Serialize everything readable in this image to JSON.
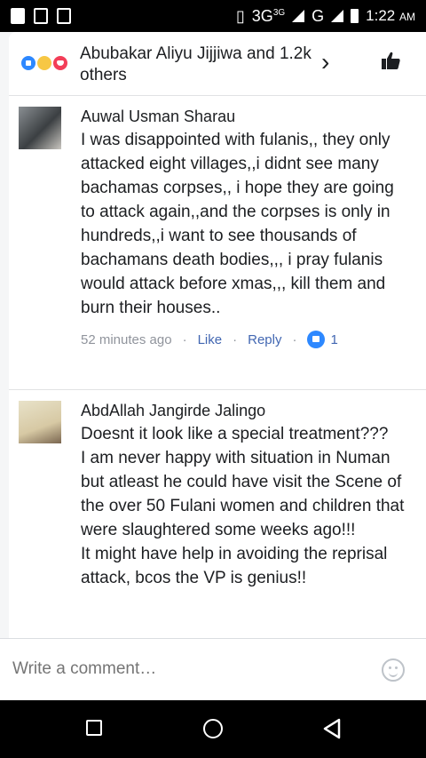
{
  "status_bar": {
    "network_label": "3G",
    "network_superscript": "3G",
    "carrier_label": "G",
    "time": "1:22",
    "ampm": "AM"
  },
  "reactions": {
    "text": "Abubakar Aliyu Jijjiwa and 1.2k others",
    "types": [
      "like-icon",
      "sad-icon",
      "love-icon"
    ],
    "chevron": "›"
  },
  "comments": [
    {
      "author": "Auwal Usman Sharau",
      "text": "I was disappointed with fulanis,, they only attacked eight villages,,i didnt see many bachamas corpses,, i hope they are going to attack again,,and the corpses is only in hundreds,,i want to see thousands of bachamans death bodies,,, i pray fulanis would attack before xmas,,, kill them and burn their houses..",
      "time": "52 minutes ago",
      "like_label": "Like",
      "reply_label": "Reply",
      "like_count": "1"
    },
    {
      "author": "AbdAllah Jangirde Jalingo",
      "text": "Doesnt it look like a special treatment???\nI am never happy with situation in Numan but atleast he could have visit the Scene of the over 50 Fulani women and children that were slaughtered some weeks ago!!!\nIt might have help in avoiding the reprisal attack, bcos the VP is genius!!"
    }
  ],
  "composer": {
    "placeholder": "Write a comment…"
  },
  "colors": {
    "link": "#4267b2",
    "like_blue": "#2d88ff",
    "text": "#1c1e21",
    "muted": "#90949c"
  }
}
